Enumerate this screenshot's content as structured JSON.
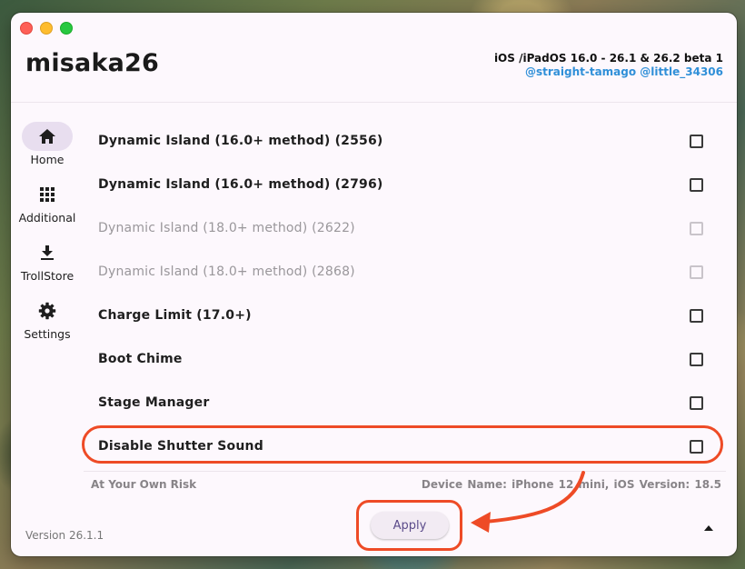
{
  "window": {
    "title": "misaka26",
    "header": {
      "version_info": "iOS /iPadOS 16.0 - 26.1 & 26.2 beta 1",
      "authors": "@straight-tamago @little_34306"
    }
  },
  "nav": {
    "items": [
      {
        "label": "Home",
        "icon": "home-icon",
        "active": true
      },
      {
        "label": "Additional",
        "icon": "grid-icon",
        "active": false
      },
      {
        "label": "TrollStore",
        "icon": "download-icon",
        "active": false
      },
      {
        "label": "Settings",
        "icon": "gear-icon",
        "active": false
      }
    ]
  },
  "tweaks": [
    {
      "label": "Dynamic Island (16.0+ method) (2556)",
      "enabled": true,
      "checked": false
    },
    {
      "label": "Dynamic Island (16.0+ method) (2796)",
      "enabled": true,
      "checked": false
    },
    {
      "label": "Dynamic Island (18.0+ method) (2622)",
      "enabled": false,
      "checked": false
    },
    {
      "label": "Dynamic Island (18.0+ method) (2868)",
      "enabled": false,
      "checked": false
    },
    {
      "label": "Charge Limit (17.0+)",
      "enabled": true,
      "checked": false
    },
    {
      "label": "Boot Chime",
      "enabled": true,
      "checked": false
    },
    {
      "label": "Stage Manager",
      "enabled": true,
      "checked": false
    },
    {
      "label": "Disable Shutter Sound",
      "enabled": true,
      "checked": false
    }
  ],
  "footer": {
    "risk": "At Your Own Risk",
    "device": "Device Name: iPhone 12 mini,  iOS Version: 18.5",
    "version": "Version 26.1.1",
    "apply_label": "Apply"
  },
  "colors": {
    "annotation": "#ee4b26",
    "authors": "#2f8fd8",
    "nav_active": "#e8deef",
    "apply_text": "#5b4b8a"
  }
}
